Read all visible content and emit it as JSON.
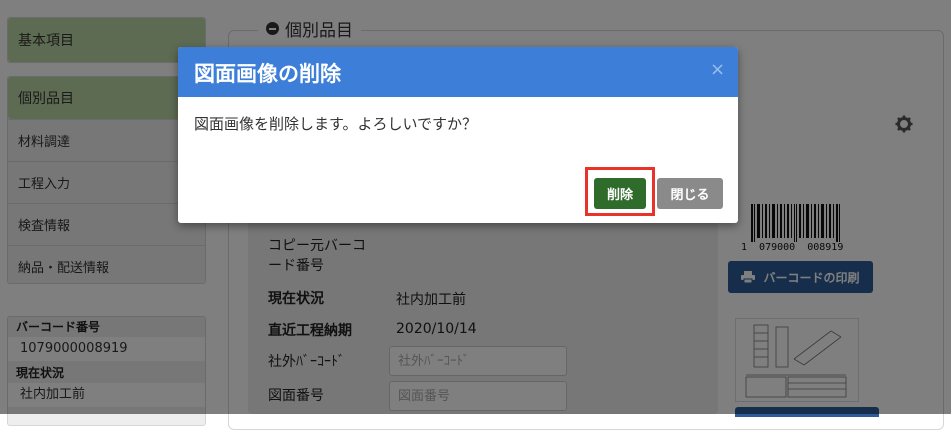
{
  "sidebar": {
    "basic_items_label": "基本項目",
    "individual_items_label": "個別品目",
    "menu": [
      {
        "label": "材料調達"
      },
      {
        "label": "工程入力"
      },
      {
        "label": "検査情報"
      },
      {
        "label": "納品・配送情報"
      }
    ],
    "info": {
      "barcode_label": "バーコード番号",
      "barcode_value": "1079000008919",
      "status_label": "現在状況",
      "status_value": "社内加工前"
    }
  },
  "main": {
    "section_title": "個別品目",
    "copy_source_label_line1": "コピー元バーコ",
    "copy_source_label_line2": "ード番号",
    "status_label": "現在状況",
    "status_value": "社内加工前",
    "recent_process_label": "直近工程納期",
    "recent_process_value": "2020/10/14",
    "external_barcode_label": "社外ﾊﾞｰｺｰﾄﾞ",
    "external_barcode_placeholder": "社外ﾊﾞｰｺｰﾄﾞ",
    "drawing_number_label": "図面番号",
    "drawing_number_placeholder": "図面番号",
    "barcode_digits": "1  079000  008919",
    "print_barcode_label": "バーコードの印刷"
  },
  "modal": {
    "title": "図面画像の削除",
    "close_glyph": "×",
    "message": "図面画像を削除します。よろしいですか？",
    "delete_label": "削除",
    "close_label": "閉じる"
  },
  "colors": {
    "modal_header": "#3c7ed8",
    "delete_button": "#2f6b2a",
    "close_button": "#8a8a8a",
    "highlight": "#e8322a",
    "sidebar_active": "#bcd6a6",
    "print_button": "#2d5d99"
  }
}
